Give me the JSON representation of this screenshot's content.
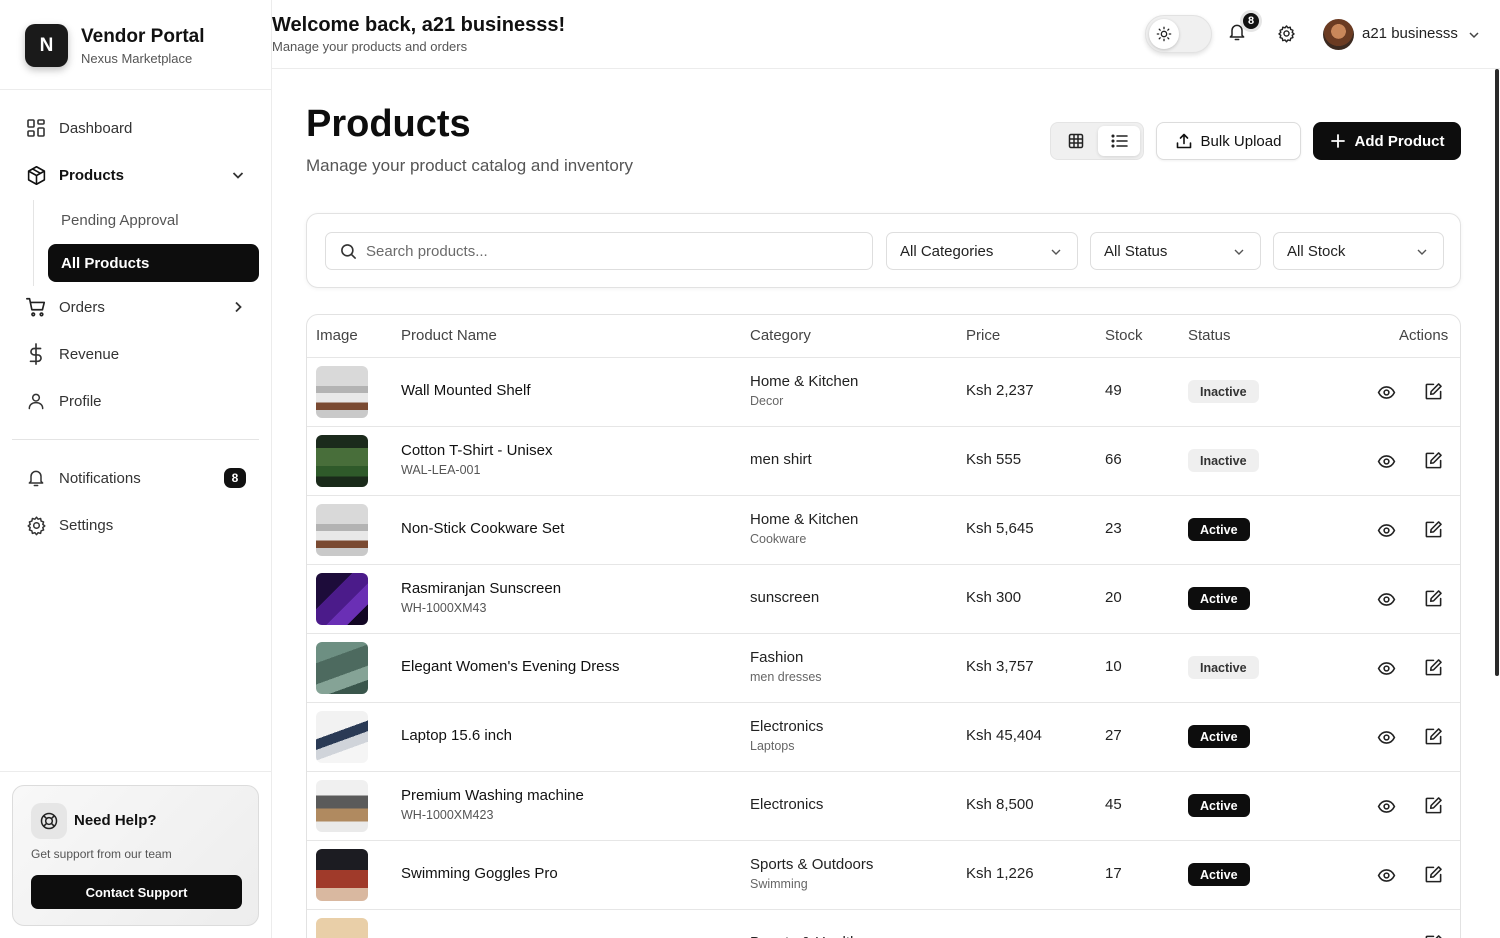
{
  "brand": {
    "logo_letter": "N",
    "title": "Vendor Portal",
    "subtitle": "Nexus Marketplace"
  },
  "sidebar": {
    "dashboard": "Dashboard",
    "products": "Products",
    "pending_approval": "Pending Approval",
    "all_products": "All Products",
    "orders": "Orders",
    "revenue": "Revenue",
    "profile": "Profile",
    "notifications": "Notifications",
    "notifications_count": "8",
    "settings": "Settings"
  },
  "help": {
    "title": "Need Help?",
    "subtitle": "Get support from our team",
    "button": "Contact Support"
  },
  "header": {
    "welcome": "Welcome back, a21 businesss!",
    "subtitle": "Manage your products and orders",
    "bell_count": "8",
    "user_name": "a21 businesss"
  },
  "page": {
    "title": "Products",
    "subtitle": "Manage your product catalog and inventory",
    "bulk_upload": "Bulk Upload",
    "add_product": "Add Product"
  },
  "filters": {
    "search_placeholder": "Search products...",
    "category": "All Categories",
    "status": "All Status",
    "stock": "All Stock"
  },
  "table": {
    "headers": {
      "image": "Image",
      "name": "Product Name",
      "category": "Category",
      "price": "Price",
      "stock": "Stock",
      "status": "Status",
      "actions": "Actions"
    },
    "rows": [
      {
        "name": "Wall Mounted Shelf",
        "sku": "",
        "category": "Home & Kitchen",
        "subcategory": "Decor",
        "price": "Ksh 2,237",
        "stock": "49",
        "status": "Inactive"
      },
      {
        "name": "Cotton T-Shirt - Unisex",
        "sku": "WAL-LEA-001",
        "category": "men shirt",
        "subcategory": "",
        "price": "Ksh 555",
        "stock": "66",
        "status": "Inactive"
      },
      {
        "name": "Non-Stick Cookware Set",
        "sku": "",
        "category": "Home & Kitchen",
        "subcategory": "Cookware",
        "price": "Ksh 5,645",
        "stock": "23",
        "status": "Active"
      },
      {
        "name": "Rasmiranjan Sunscreen",
        "sku": "WH-1000XM43",
        "category": "sunscreen",
        "subcategory": "",
        "price": "Ksh 300",
        "stock": "20",
        "status": "Active"
      },
      {
        "name": "Elegant Women's Evening Dress",
        "sku": "",
        "category": "Fashion",
        "subcategory": "men dresses",
        "price": "Ksh 3,757",
        "stock": "10",
        "status": "Inactive"
      },
      {
        "name": "Laptop 15.6 inch",
        "sku": "",
        "category": "Electronics",
        "subcategory": "Laptops",
        "price": "Ksh 45,404",
        "stock": "27",
        "status": "Active"
      },
      {
        "name": "Premium Washing machine",
        "sku": "WH-1000XM423",
        "category": "Electronics",
        "subcategory": "",
        "price": "Ksh 8,500",
        "stock": "45",
        "status": "Active"
      },
      {
        "name": "Swimming Goggles Pro",
        "sku": "",
        "category": "Sports & Outdoors",
        "subcategory": "Swimming",
        "price": "Ksh 1,226",
        "stock": "17",
        "status": "Active"
      },
      {
        "name": "",
        "sku": "",
        "category": "Beauty & Health",
        "subcategory": "",
        "price": "",
        "stock": "",
        "status": ""
      }
    ]
  },
  "colors": {
    "accent": "#0d0d0d",
    "inactive_badge": "#efefef",
    "border": "#e2e2e2"
  }
}
